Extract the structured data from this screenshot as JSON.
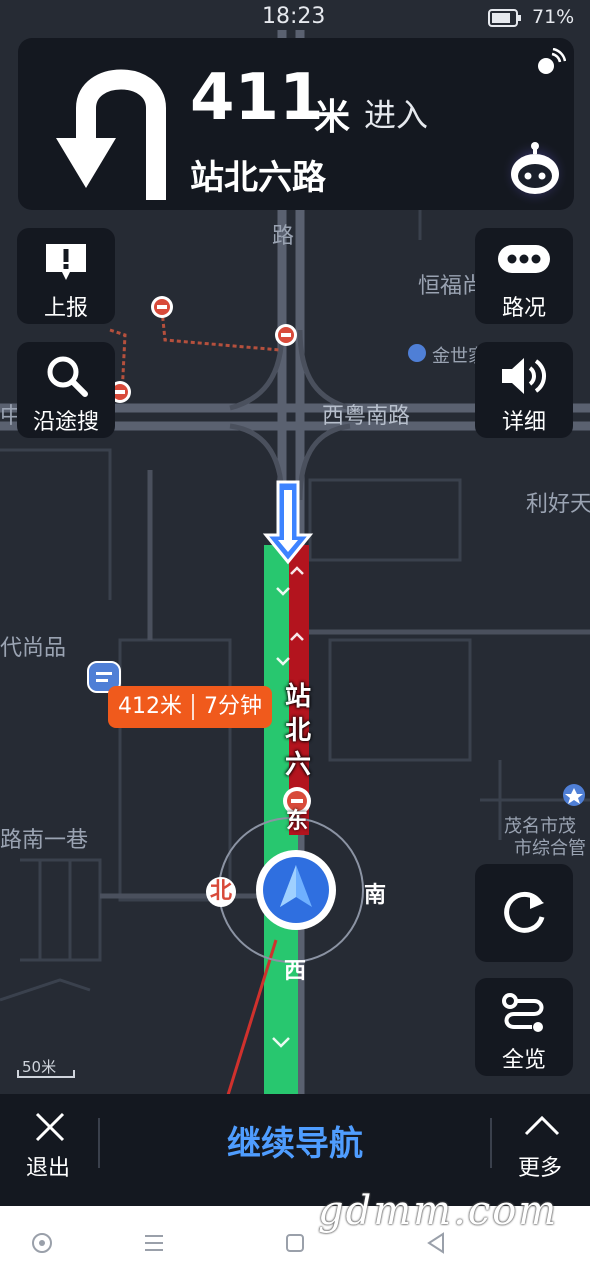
{
  "status": {
    "time": "18:23",
    "battery": "71%"
  },
  "guidance": {
    "distance": "411",
    "unit": "米",
    "action": "进入",
    "road": "站北六路",
    "turn": "u-turn-icon"
  },
  "left_buttons": [
    {
      "label": "上报",
      "icon": "report-icon"
    },
    {
      "label": "沿途搜",
      "icon": "search-icon"
    }
  ],
  "right_buttons": [
    {
      "label": "路况",
      "icon": "traffic-icon"
    },
    {
      "label": "详细",
      "icon": "volume-icon"
    },
    {
      "label": "",
      "icon": "refresh-icon"
    },
    {
      "label": "全览",
      "icon": "route-overview-icon"
    }
  ],
  "map_labels": [
    "路",
    "恒福尚",
    "金世家",
    "西粤南路",
    "利好天",
    "代尚品",
    "路南一巷",
    "茂名市茂",
    "市综合管",
    "中"
  ],
  "vertical_road": [
    "站",
    "北",
    "六"
  ],
  "eta": {
    "distance": "412米",
    "time": "7分钟"
  },
  "compass": {
    "north": "北",
    "south": "南",
    "east": "东",
    "west": "西"
  },
  "scale": "50米",
  "bottom": {
    "exit": "退出",
    "continue": "继续导航",
    "more": "更多"
  },
  "watermark": "gdmm.com",
  "colors": {
    "route_green": "#28c76f",
    "congestion_red": "#b3141e",
    "accent_blue": "#4f9dff",
    "eta_orange": "#f05a1c"
  }
}
